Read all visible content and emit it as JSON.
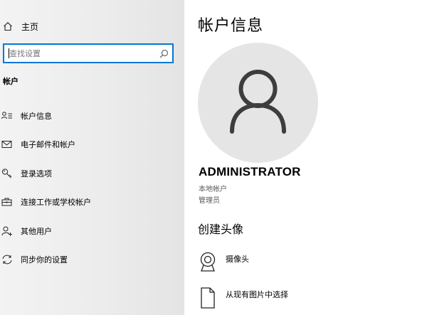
{
  "sidebar": {
    "home_label": "主页",
    "search_placeholder": "查找设置",
    "section_title": "帐户",
    "items": [
      {
        "label": "帐户信息",
        "icon": "person-card-icon"
      },
      {
        "label": "电子邮件和帐户",
        "icon": "mail-icon"
      },
      {
        "label": "登录选项",
        "icon": "key-icon"
      },
      {
        "label": "连接工作或学校帐户",
        "icon": "briefcase-icon"
      },
      {
        "label": "其他用户",
        "icon": "add-person-icon"
      },
      {
        "label": "同步你的设置",
        "icon": "sync-icon"
      }
    ]
  },
  "main": {
    "title": "帐户信息",
    "user_name": "ADMINISTRATOR",
    "account_type": "本地帐户",
    "account_role": "管理员",
    "create_heading": "创建头像",
    "options": [
      {
        "label": "摄像头",
        "icon": "camera-icon"
      },
      {
        "label": "从现有图片中选择",
        "icon": "picture-file-icon"
      }
    ]
  },
  "colors": {
    "accent": "#0078d7",
    "avatar_bg": "#e5e5e5",
    "avatar_fg": "#3d3d3d",
    "secondary_text": "#5a5a5a"
  }
}
